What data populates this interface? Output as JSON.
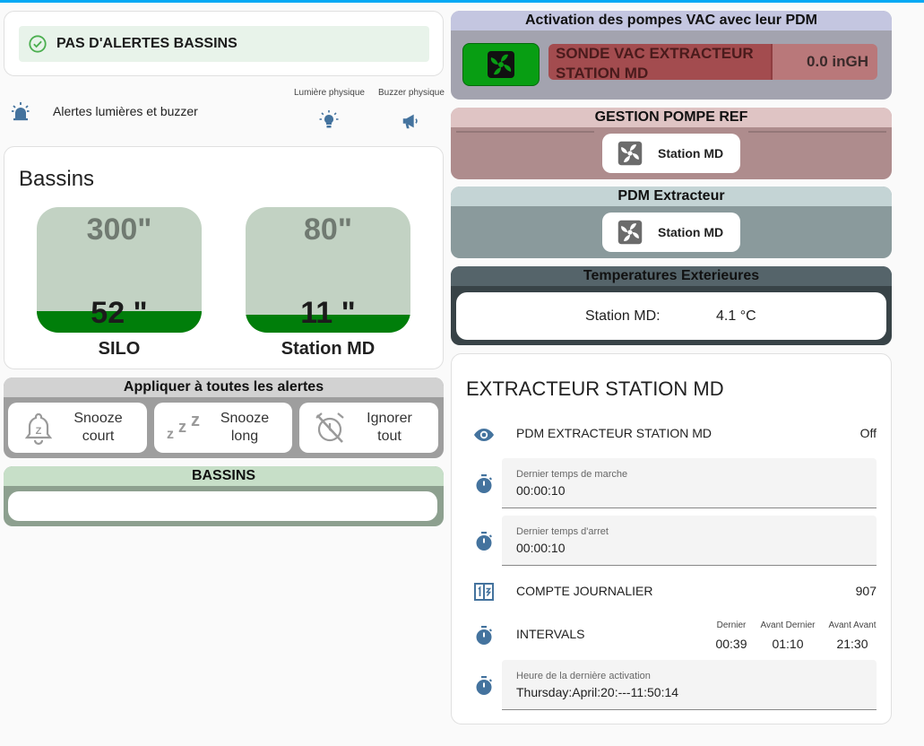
{
  "alerts": {
    "status_text": "PAS D'ALERTES BASSINS"
  },
  "lights": {
    "label": "Alertes lumières et buzzer",
    "light_header": "Lumière physique",
    "buzzer_header": "Buzzer physique"
  },
  "bassins": {
    "title": "Bassins",
    "tanks": [
      {
        "name": "SILO",
        "capacity": "300\"",
        "level": "52 \"",
        "fill_fraction": 0.17
      },
      {
        "name": "Station MD",
        "capacity": "80\"",
        "level": "11 \"",
        "fill_fraction": 0.14
      }
    ]
  },
  "apply_all": {
    "title": "Appliquer à toutes les alertes",
    "buttons": [
      {
        "line1": "Snooze",
        "line2": "court"
      },
      {
        "line1": "Snooze",
        "line2": "long"
      },
      {
        "line1": "Ignorer",
        "line2": "tout"
      }
    ]
  },
  "bassins_panel": {
    "title": "BASSINS"
  },
  "vac": {
    "title": "Activation des pompes VAC avec leur PDM",
    "sensor_line1": "SONDE VAC EXTRACTEUR",
    "sensor_line2": "STATION MD",
    "sensor_value": "0.0 inGH",
    "sensor_fill_fraction": 0.68
  },
  "pompe_ref": {
    "title": "GESTION POMPE REF",
    "button_label": "Station MD"
  },
  "pdm_extracteur": {
    "title": "PDM Extracteur",
    "button_label": "Station MD"
  },
  "temperatures": {
    "title": "Temperatures Exterieures",
    "station_label": "Station MD:",
    "station_value": "4.1 °C"
  },
  "extracteur": {
    "title": "EXTRACTEUR STATION MD",
    "pdm_label": "PDM EXTRACTEUR STATION MD",
    "pdm_state": "Off",
    "last_run_label": "Dernier temps de marche",
    "last_run_value": "00:00:10",
    "last_stop_label": "Dernier temps d'arret",
    "last_stop_value": "00:00:10",
    "daily_count_label": "COMPTE JOURNALIER",
    "daily_count_value": "907",
    "intervals_label": "INTERVALS",
    "intervals": [
      {
        "header": "Dernier",
        "value": "00:39"
      },
      {
        "header": "Avant Dernier",
        "value": "01:10"
      },
      {
        "header": "Avant Avant",
        "value": "21:30"
      }
    ],
    "last_activation_label": "Heure de la dernière activation",
    "last_activation_value": "Thursday:April:20:---11:50:14"
  },
  "colors": {
    "accent_blue": "#03a9f4",
    "icon_blue": "#44739e",
    "ok_green": "#4caf50",
    "tank_fill": "#007e0a",
    "vac_header": "#c4c6e0",
    "pompe_ref_header": "#dfc4c4",
    "pdm_header": "#c4d4d5",
    "temp_header": "#55646a"
  }
}
